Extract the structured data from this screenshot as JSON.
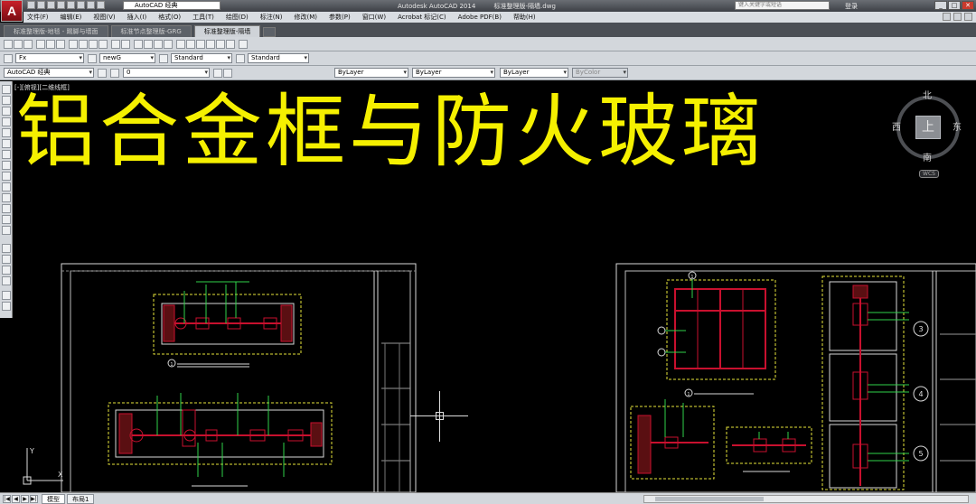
{
  "titlebar": {
    "app_logo": "A",
    "workspace": "AutoCAD 经典",
    "product": "Autodesk AutoCAD 2014",
    "filename": "标准整理版-隔墙.dwg",
    "search_placeholder": "键入关键字或短语",
    "login": "登录"
  },
  "menubar": {
    "items": [
      "文件(F)",
      "编辑(E)",
      "视图(V)",
      "插入(I)",
      "格式(O)",
      "工具(T)",
      "绘图(D)",
      "标注(N)",
      "修改(M)",
      "参数(P)",
      "窗口(W)",
      "Acrobat 标记(C)",
      "Adobe PDF(B)",
      "帮助(H)"
    ]
  },
  "doc_tabs": [
    "标准整理版-地毯 - 踢脚与墙面",
    "标准节点整理版-GRG",
    "标准整理版-隔墙"
  ],
  "toolbars": {
    "text_style_font": "Fx",
    "dim_style": "newG",
    "table_style": "Standard",
    "mleader_style": "Standard",
    "workspace2": "AutoCAD 经典",
    "layer_current": "0",
    "color": "ByLayer",
    "linetype": "ByLayer",
    "lineweight": "ByLayer",
    "plot_style": "ByColor"
  },
  "canvas": {
    "view_label": "[-][俯视][二维线框]",
    "overlay_title": "铝合金框与防火玻璃",
    "viewcube": {
      "north": "北",
      "south": "南",
      "east": "东",
      "west": "西",
      "face": "上",
      "wcs": "WCS"
    },
    "ucs_x": "X",
    "ucs_y": "Y"
  },
  "layout_tabs": [
    "模型",
    "布局1"
  ],
  "drawing_callouts": [
    "3",
    "4",
    "5",
    "1",
    "1",
    "1"
  ],
  "colors": {
    "background": "#000000",
    "overlay_text": "#f5f000",
    "frame_red": "#c8102e",
    "hatch_dark_red": "#5a0f12",
    "leader_green": "#2fd24a",
    "hidden_yellow": "#e6e33a",
    "line_white": "#d8d8d8"
  }
}
